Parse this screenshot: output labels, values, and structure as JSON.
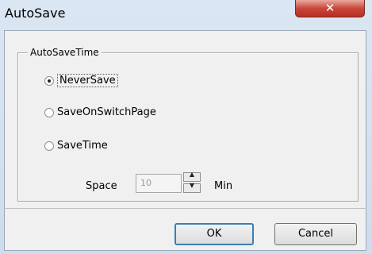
{
  "window": {
    "title": "AutoSave"
  },
  "titlebar": {
    "close_glyph": "✕"
  },
  "group": {
    "label": "AutoSaveTime"
  },
  "options": [
    {
      "label": "NeverSave",
      "checked": true
    },
    {
      "label": "SaveOnSwitchPage",
      "checked": false
    },
    {
      "label": "SaveTime",
      "checked": false
    }
  ],
  "interval": {
    "label": "Space",
    "value": "10",
    "unit": "Min",
    "up_glyph": "▲",
    "down_glyph": "▼"
  },
  "buttons": {
    "ok": "OK",
    "cancel": "Cancel"
  }
}
